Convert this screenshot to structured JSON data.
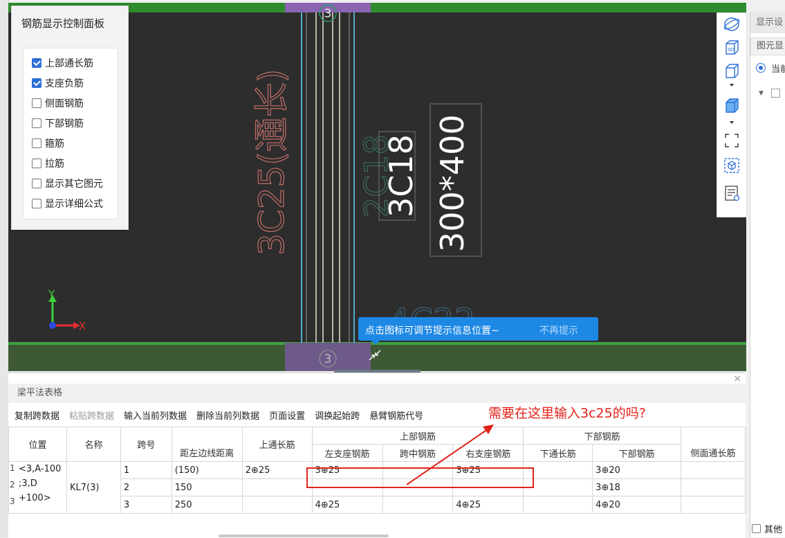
{
  "canvas": {
    "axis_number": "3",
    "axis_number_bottom": "3",
    "rebar_label_left": "3C25(通长)",
    "rebar_label_mid": "3C18",
    "section_label": "300*400",
    "ghost_label_1": "2C18",
    "ghost_label_2": "4C22",
    "axis_y": "Y",
    "axis_x": "X"
  },
  "control_panel": {
    "title": "钢筋显示控制面板",
    "options": [
      {
        "label": "上部通长筋",
        "checked": true
      },
      {
        "label": "支座负筋",
        "checked": true
      },
      {
        "label": "侧面钢筋",
        "checked": false
      },
      {
        "label": "下部钢筋",
        "checked": false
      },
      {
        "label": "箍筋",
        "checked": false
      },
      {
        "label": "拉筋",
        "checked": false
      },
      {
        "label": "显示其它图元",
        "checked": false
      },
      {
        "label": "显示详细公式",
        "checked": false
      }
    ]
  },
  "toolbar_icons": [
    "orbit-icon",
    "3d-view-icon",
    "box-view-icon",
    "solid-box-icon",
    "zoom-extents-icon",
    "view-cube-icon",
    "properties-icon"
  ],
  "right_panel": {
    "header": "显示设",
    "tab": "图元显",
    "radio_label": "当前",
    "bottom_checkbox": "其他"
  },
  "tooltip": {
    "text": "点击图标可调节提示信息位置~",
    "dismiss": "不再提示"
  },
  "bottom_panel": {
    "title": "梁平法表格",
    "close": "×",
    "toolbar": [
      {
        "label": "复制跨数据",
        "enabled": true
      },
      {
        "label": "粘贴跨数据",
        "enabled": false
      },
      {
        "label": "输入当前列数据",
        "enabled": true
      },
      {
        "label": "删除当前列数据",
        "enabled": true
      },
      {
        "label": "页面设置",
        "enabled": true
      },
      {
        "label": "调换起始跨",
        "enabled": true
      },
      {
        "label": "悬臂钢筋代号",
        "enabled": true
      }
    ],
    "table": {
      "headers": {
        "position": "位置",
        "name": "名称",
        "span": "跨号",
        "edge_distance": "距左边线距离",
        "top_through": "上通长筋",
        "top_rebar": "上部钢筋",
        "left_support": "左支座钢筋",
        "mid_span": "跨中钢筋",
        "right_support": "右支座钢筋",
        "bottom_rebar": "下部钢筋",
        "bottom_through": "下通长筋",
        "bottom_bars": "下部钢筋",
        "side_through": "侧面通长筋"
      },
      "position_lines": [
        "<3,A-100",
        ";3,D",
        "+100>"
      ],
      "name": "KL7(3)",
      "rows": [
        {
          "num": "1",
          "span": "1",
          "dist": "(150)",
          "top_through": "2⊕25",
          "left": "3⊕25",
          "mid": "",
          "right": "3⊕25",
          "bottom_through": "",
          "bottom": "3⊕20",
          "side": ""
        },
        {
          "num": "2",
          "span": "2",
          "dist": "150",
          "top_through": "",
          "left": "",
          "mid": "",
          "right": "",
          "bottom_through": "",
          "bottom": "3⊕18",
          "side": ""
        },
        {
          "num": "3",
          "span": "3",
          "dist": "250",
          "top_through": "",
          "left": "4⊕25",
          "mid": "",
          "right": "4⊕25",
          "bottom_through": "",
          "bottom": "4⊕20",
          "side": ""
        }
      ]
    }
  },
  "annotation": {
    "text": "需要在这里输入3c25的吗?",
    "color": "#e2231a"
  }
}
